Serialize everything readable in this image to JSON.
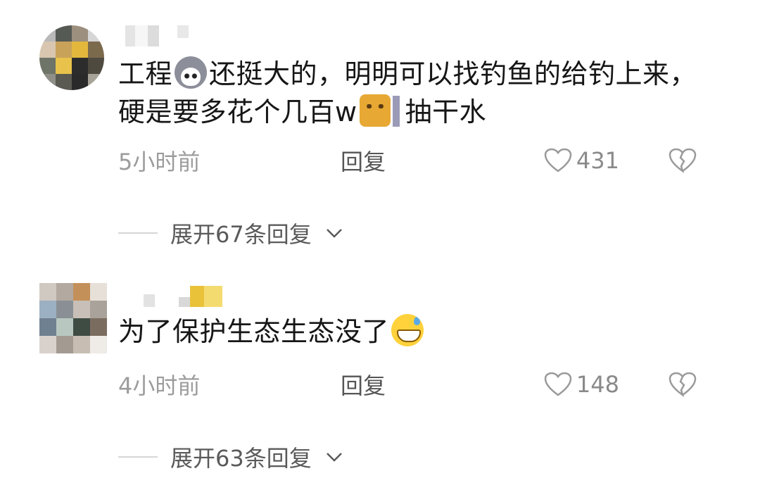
{
  "comments": [
    {
      "text_parts": [
        "工程",
        "还挺大的，明明可以找钓鱼的给钓上来，硬是要多花个几百w",
        "抽干水"
      ],
      "time": "5小时前",
      "reply": "回复",
      "likes": "431",
      "expand": "展开67条回复",
      "emojis": [
        "husky-emoji",
        "cat-emoji"
      ]
    },
    {
      "text_parts": [
        "为了保护生态生态没了"
      ],
      "time": "4小时前",
      "reply": "回复",
      "likes": "148",
      "expand": "展开63条回复",
      "emojis": [
        "grinning-sweat-emoji"
      ]
    }
  ],
  "colors": {
    "muted": "#9c9c9c",
    "text": "#161616"
  }
}
